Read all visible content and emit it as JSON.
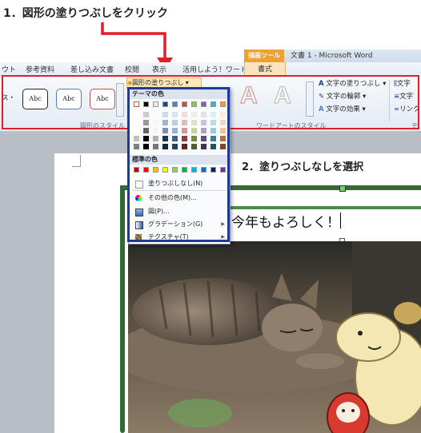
{
  "step1": {
    "label": "1．図形の塗りつぶしをクリック"
  },
  "step2": {
    "label": "2．塗りつぶしなしを選択"
  },
  "window": {
    "title": "文書 1 - Microsoft Word",
    "ctx_tools": "描画ツール",
    "ctx_format": "書式"
  },
  "tabs": [
    "ウト",
    "参考資料",
    "差し込み文書",
    "校閲",
    "表示",
    "活用しよう！ワード"
  ],
  "ribbon": {
    "abc_label": "Abc",
    "left_fragment": "ス・",
    "fill_button": "図形の塗りつぶし",
    "group_shape_styles": "図形のスタイル",
    "group_wordart": "ワードアートのスタイル",
    "wordart_letter": "A",
    "text_fill": "文字の塗りつぶし",
    "text_outline": "文字の輪郭",
    "text_effects": "文字の効果",
    "far_right_1": "文字",
    "far_right_2": "文字",
    "far_right_3": "リンク",
    "far_right_group": "テ"
  },
  "dropdown": {
    "theme_header": "テーマの色",
    "standard_header": "標準の色",
    "no_fill": "塗りつぶしなし(N)",
    "more_colors": "その他の色(M)...",
    "picture": "図(P)...",
    "gradient": "グラデーション(G)",
    "texture": "テクスチャ(T)",
    "theme_colors": [
      "#ffffff",
      "#000000",
      "#eeece1",
      "#1f497d",
      "#4f81bd",
      "#c0504d",
      "#9bbb59",
      "#8064a2",
      "#4bacc6",
      "#f79646"
    ],
    "standard_colors": [
      "#c00000",
      "#ff0000",
      "#ffc000",
      "#ffff00",
      "#92d050",
      "#00b050",
      "#00b0f0",
      "#0070c0",
      "#002060",
      "#7030a0"
    ]
  },
  "document": {
    "greeting": "今年もよろしく！"
  },
  "colors": {
    "accent_red": "#e01f26",
    "accent_blue": "#1e3c96",
    "frame_green": "#2f6b34"
  }
}
